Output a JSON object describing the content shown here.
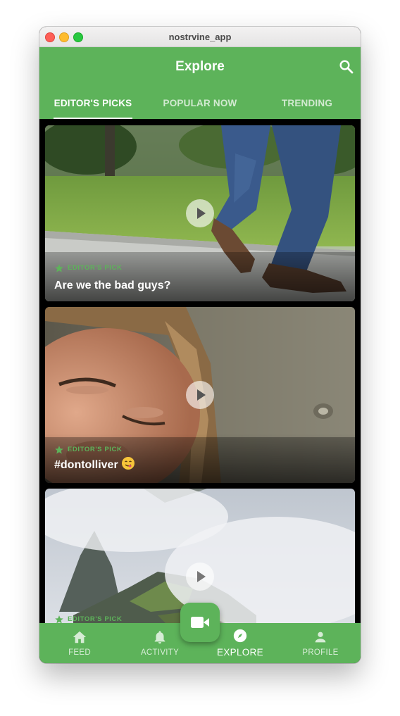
{
  "window": {
    "title": "nostrvine_app"
  },
  "appbar": {
    "title": "Explore"
  },
  "tabs": [
    {
      "label": "EDITOR'S PICKS",
      "active": true
    },
    {
      "label": "POPULAR NOW",
      "active": false
    },
    {
      "label": "TRENDING",
      "active": false
    }
  ],
  "cards": [
    {
      "badge": "EDITOR'S PICK",
      "title": "Are we the bad guys?",
      "emoji": ""
    },
    {
      "badge": "EDITOR'S PICK",
      "title": "#dontolliver",
      "emoji": "😋"
    },
    {
      "badge": "EDITOR'S PICK",
      "title": "",
      "emoji": ""
    }
  ],
  "bottom_nav": [
    {
      "label": "FEED",
      "icon": "home-icon",
      "active": false
    },
    {
      "label": "ACTIVITY",
      "icon": "bell-icon",
      "active": false
    },
    {
      "label": "EXPLORE",
      "icon": "compass-icon",
      "active": true
    },
    {
      "label": "PROFILE",
      "icon": "person-icon",
      "active": false
    }
  ],
  "fab": {
    "icon": "video-camera-icon"
  },
  "colors": {
    "accent": "#5db35a",
    "background": "#000000"
  }
}
